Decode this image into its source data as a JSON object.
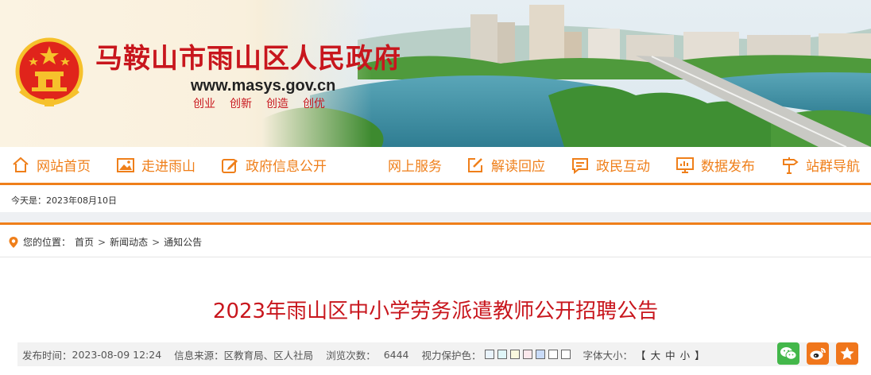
{
  "header": {
    "site_title": "马鞍山市雨山区人民政府",
    "site_url": "www.masys.gov.cn",
    "slogans": [
      "创业",
      "创新",
      "创造",
      "创优"
    ],
    "emblem_icon": "national-emblem-icon"
  },
  "nav": {
    "items": [
      {
        "label": "网站首页",
        "icon": "home-icon"
      },
      {
        "label": "走进雨山",
        "icon": "picture-icon"
      },
      {
        "label": "政府信息公开",
        "icon": "edit-icon"
      },
      {
        "label": "网上服务",
        "icon": ""
      },
      {
        "label": "解读回应",
        "icon": "pen-square-icon"
      },
      {
        "label": "政民互动",
        "icon": "message-icon"
      },
      {
        "label": "数据发布",
        "icon": "monitor-chart-icon"
      },
      {
        "label": "站群导航",
        "icon": "signpost-icon"
      }
    ]
  },
  "today": "今天是：2023年08月10日",
  "breadcrumb": {
    "prefix": "您的位置：",
    "items": [
      "首页",
      "新闻动态",
      "通知公告"
    ],
    "separator": ">"
  },
  "article": {
    "title": "2023年雨山区中小学劳务派遣教师公开招聘公告",
    "publish_label": "发布时间：",
    "publish_time": "2023-08-09 12:24",
    "source_label": "信息来源：",
    "source": "区教育局、区人社局",
    "views_label": "浏览次数：",
    "views": "6444",
    "eye_care_label": "视力保护色：",
    "eye_care_colors": [
      "#e9f3fb",
      "#dff6f8",
      "#faf9de",
      "#fbe8ec",
      "#c9dbf8",
      "#ffffff",
      "#ffffff"
    ],
    "font_size_label": "字体大小：",
    "font_size_open": "【",
    "font_sizes": [
      "大",
      "中",
      "小"
    ],
    "font_size_close": "】"
  },
  "share": {
    "wechat_color": "#43b74a",
    "weibo_color": "#f0761b",
    "favorite_color": "#f0761b"
  },
  "colors": {
    "accent": "#ef7f1a",
    "title_red": "#c8161d"
  }
}
